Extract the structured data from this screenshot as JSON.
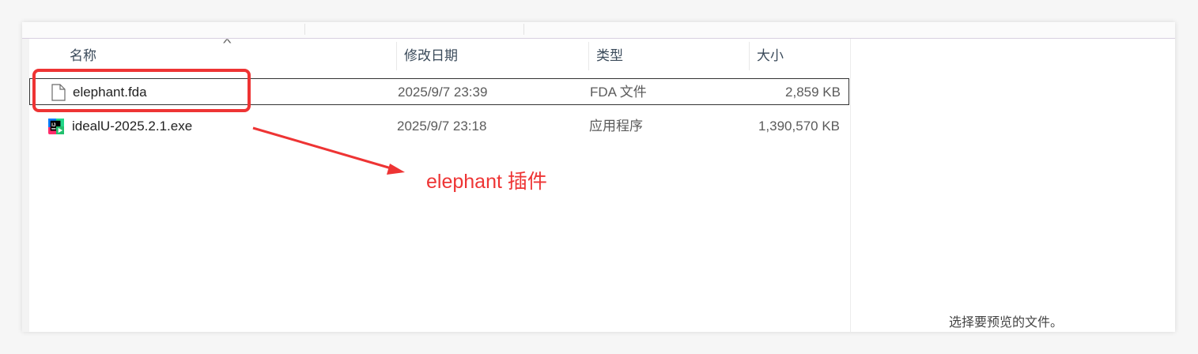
{
  "columns": {
    "name": "名称",
    "modified": "修改日期",
    "type": "类型",
    "size": "大小"
  },
  "sort_indicator": "^",
  "files": [
    {
      "name": "elephant.fda",
      "modified": "2025/9/7 23:39",
      "type": "FDA 文件",
      "size": "2,859 KB",
      "icon": "blank-file-icon",
      "selected": true
    },
    {
      "name": "idealU-2025.2.1.exe",
      "modified": "2025/9/7 23:18",
      "type": "应用程序",
      "size": "1,390,570 KB",
      "icon": "intellij-idea-icon",
      "selected": false
    }
  ],
  "preview_pane": {
    "message": "选择要预览的文件。"
  },
  "annotation": {
    "text": "elephant 插件",
    "color": "#ee3434"
  }
}
